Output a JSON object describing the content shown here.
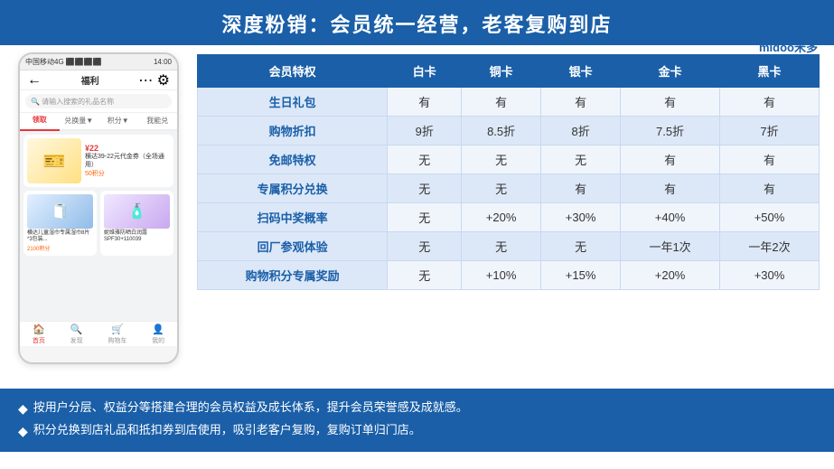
{
  "header": {
    "title": "深度粉销：会员统一经营，老客复购到店"
  },
  "logo": {
    "text": "midoo米多"
  },
  "phone": {
    "status_bar": "中国移动4G",
    "time": "14:00",
    "nav_title": "福利",
    "search_placeholder": "请输入搜索的礼品名称",
    "tabs": [
      "领取",
      "兑换量▼",
      "积分▼",
      "我能兑"
    ],
    "active_tab": "领取",
    "products": [
      {
        "emoji": "🎫",
        "price": "¥22",
        "title": "横达39-22元代金券（全场通用）",
        "points": "50积分",
        "type": "yellow"
      },
      {
        "emoji": "🧻",
        "title": "横达儿童湿巾专用湿巾8片*3包装...",
        "points": "2100积分",
        "type": "blue"
      },
      {
        "emoji": "🧴",
        "price": "",
        "title": "妮维雅防晒白润露SPF30+11003g",
        "points": "",
        "type": "purple"
      }
    ],
    "bottom_nav": [
      "首页",
      "发现",
      "购物车",
      "我的"
    ]
  },
  "table": {
    "headers": [
      "会员特权",
      "白卡",
      "铜卡",
      "银卡",
      "金卡",
      "黑卡"
    ],
    "rows": [
      {
        "feature": "生日礼包",
        "white": "有",
        "copper": "有",
        "silver": "有",
        "gold": "有",
        "black": "有"
      },
      {
        "feature": "购物折扣",
        "white": "9折",
        "copper": "8.5折",
        "silver": "8折",
        "gold": "7.5折",
        "black": "7折"
      },
      {
        "feature": "免邮特权",
        "white": "无",
        "copper": "无",
        "silver": "无",
        "gold": "有",
        "black": "有"
      },
      {
        "feature": "专属积分兑换",
        "white": "无",
        "copper": "无",
        "silver": "有",
        "gold": "有",
        "black": "有"
      },
      {
        "feature": "扫码中奖概率",
        "white": "无",
        "copper": "+20%",
        "silver": "+30%",
        "gold": "+40%",
        "black": "+50%"
      },
      {
        "feature": "回厂参观体验",
        "white": "无",
        "copper": "无",
        "silver": "无",
        "gold": "一年1次",
        "black": "一年2次"
      },
      {
        "feature": "购物积分专属奖励",
        "white": "无",
        "copper": "+10%",
        "silver": "+15%",
        "gold": "+20%",
        "black": "+30%"
      }
    ]
  },
  "footer": {
    "items": [
      "按用户分层、权益分等搭建合理的会员权益及成长体系，提升会员荣誉感及成就感。",
      "积分兑换到店礼品和抵扣券到店使用，吸引老客户复购，复购订单归门店。"
    ]
  }
}
